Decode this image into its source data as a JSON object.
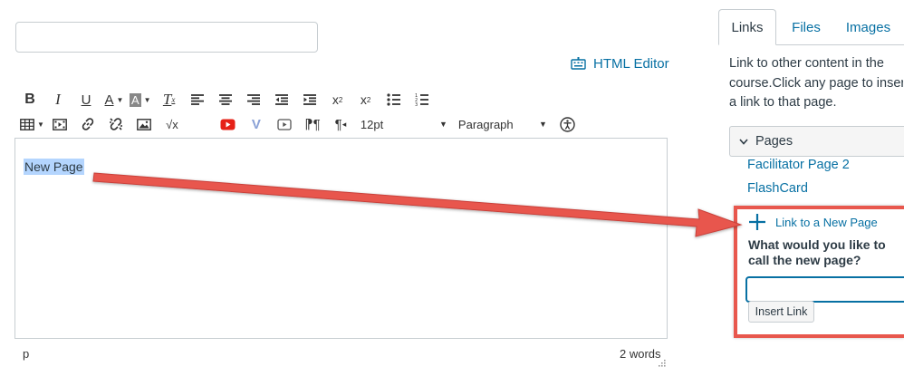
{
  "editor": {
    "title_value": "",
    "html_editor_label": "HTML Editor",
    "content_text": "New Page",
    "status_path": "p",
    "word_count": "2 words"
  },
  "toolbar": {
    "font_size": "12pt",
    "block_format": "Paragraph",
    "row1_icons": [
      "bold-icon",
      "italic-icon",
      "underline-icon",
      "text-color-icon",
      "background-color-icon",
      "clear-formatting-icon",
      "align-left-icon",
      "align-center-icon",
      "align-right-icon",
      "outdent-icon",
      "indent-icon",
      "superscript-icon",
      "subscript-icon",
      "bullet-list-icon",
      "numbered-list-icon"
    ],
    "row2_icons": [
      "table-icon",
      "media-icon",
      "link-icon",
      "unlink-icon",
      "image-icon",
      "equation-icon",
      "youtube-icon",
      "vimeo-icon",
      "video-icon",
      "ltr-icon",
      "rtl-icon",
      "accessibility-icon"
    ]
  },
  "sidebar": {
    "tabs": [
      {
        "label": "Links",
        "active": true
      },
      {
        "label": "Files",
        "active": false
      },
      {
        "label": "Images",
        "active": false
      }
    ],
    "description": [
      "Link to other content in the",
      "course.Click any page to insert",
      "a link to that page."
    ],
    "pages_label": "Pages",
    "page_links": [
      "Facilitator Page 2",
      "FlashCard"
    ],
    "new_page_link": "Link to a New Page",
    "new_page_question": "What would you like to call the new page?",
    "new_page_value": "",
    "insert_button": "Insert Link"
  },
  "colors": {
    "link": "#0770a3",
    "highlight": "#e8574d",
    "selection": "#b4d5fe",
    "text": "#2d3b45"
  }
}
